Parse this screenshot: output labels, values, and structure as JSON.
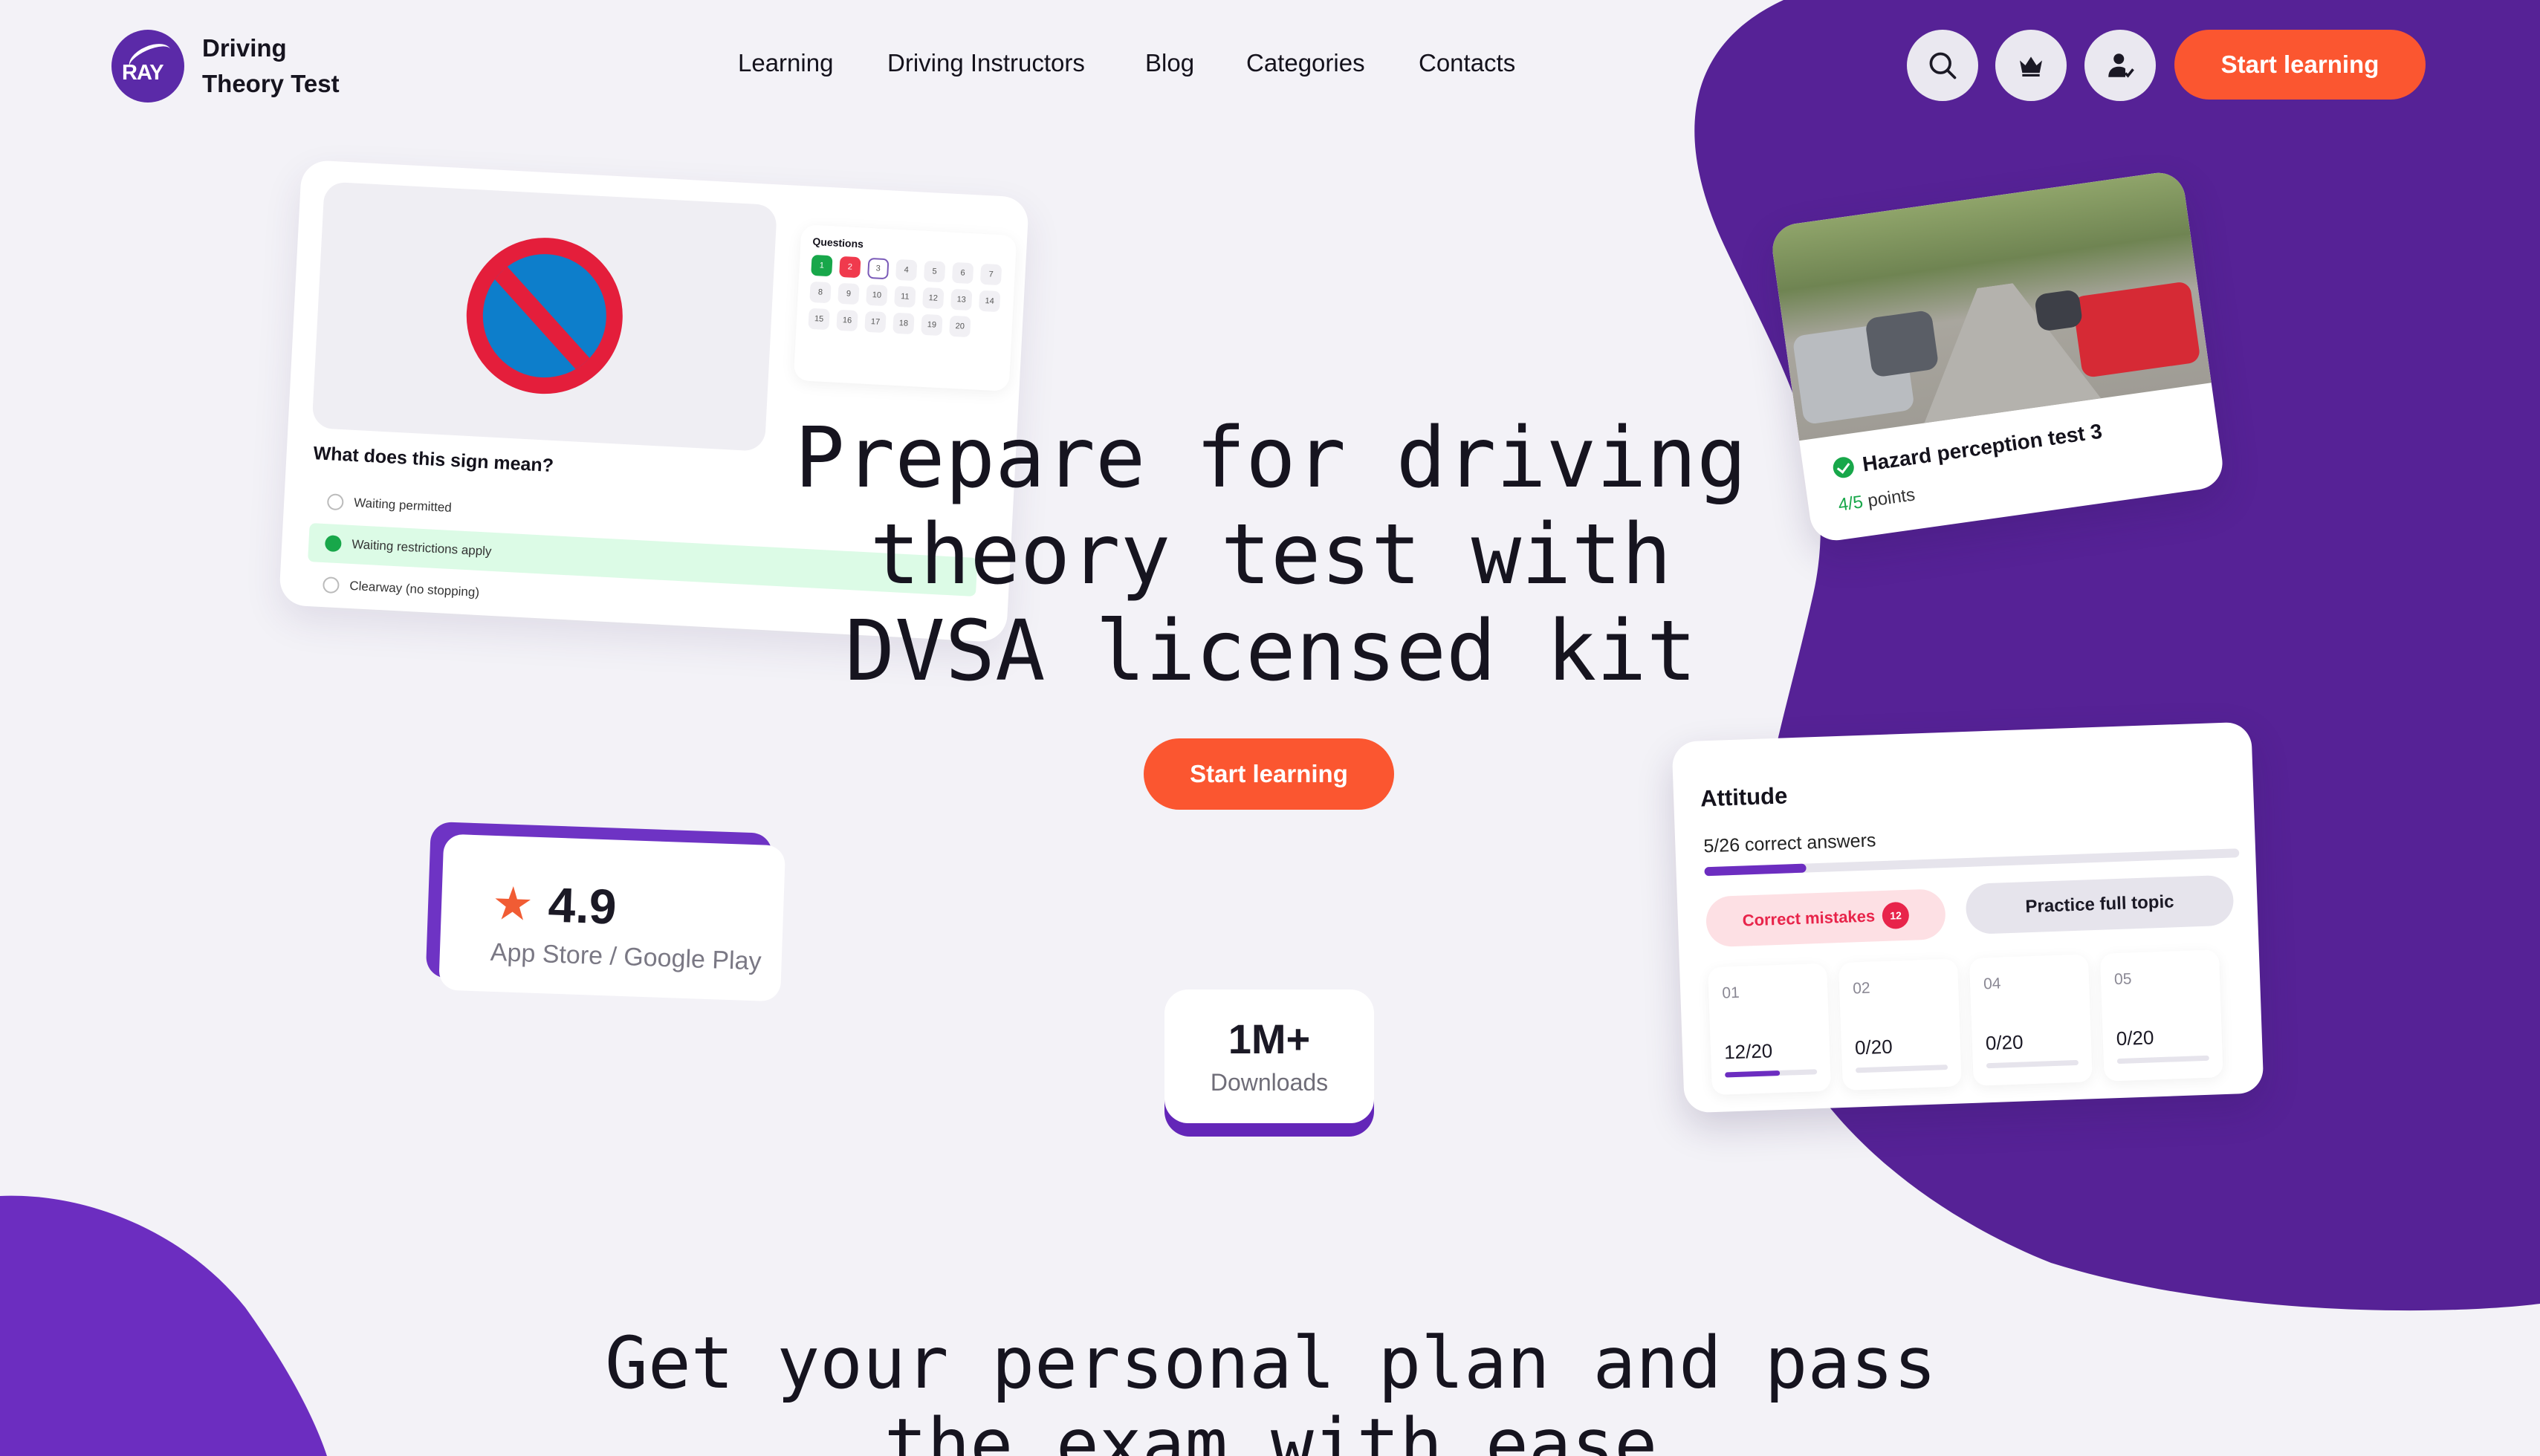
{
  "brand": {
    "line1": "Driving",
    "line2": "Theory Test",
    "logo_text": "RAY",
    "accent": "#5b2aa8",
    "cta_color": "#fb5630"
  },
  "nav": {
    "items": [
      "Learning",
      "Driving Instructors",
      "Blog",
      "Categories",
      "Contacts"
    ]
  },
  "header": {
    "icons": [
      "search-icon",
      "crown-icon",
      "user-icon"
    ],
    "cta_label": "Start learning"
  },
  "hero": {
    "title_lines": [
      "Prepare for driving",
      "theory test with",
      "DVSA licensed kit"
    ],
    "cta_label": "Start learning"
  },
  "quiz_card": {
    "grid_title": "Questions",
    "numbers": [
      "1",
      "2",
      "3",
      "4",
      "5",
      "6",
      "7",
      "8",
      "9",
      "10",
      "11",
      "12",
      "13",
      "14",
      "15",
      "16",
      "17",
      "18",
      "19",
      "20"
    ],
    "question": "What does this sign mean?",
    "options": [
      "Waiting permitted",
      "Waiting restrictions apply",
      "Clearway (no stopping)"
    ],
    "selected_option": 1
  },
  "hazard_card": {
    "title": "Hazard perception test 3",
    "score": "4/5",
    "score_unit": "points"
  },
  "rating": {
    "value": "4.9",
    "stores": "App Store / Google Play"
  },
  "downloads": {
    "value": "1M+",
    "label": "Downloads"
  },
  "attitude": {
    "title": "Attitude",
    "summary": "5/26 correct answers",
    "progress": 0.19,
    "correct_mistakes_label": "Correct mistakes",
    "mistakes_count": "12",
    "practice_label": "Practice full topic",
    "tiles": [
      {
        "num": "01",
        "value": "12/20",
        "progress": 0.6
      },
      {
        "num": "02",
        "value": "0/20",
        "progress": 0
      },
      {
        "num": "04",
        "value": "0/20",
        "progress": 0
      },
      {
        "num": "05",
        "value": "0/20",
        "progress": 0
      }
    ]
  },
  "section2": {
    "title_lines": [
      "Get your personal plan and pass",
      "the exam with ease"
    ]
  }
}
